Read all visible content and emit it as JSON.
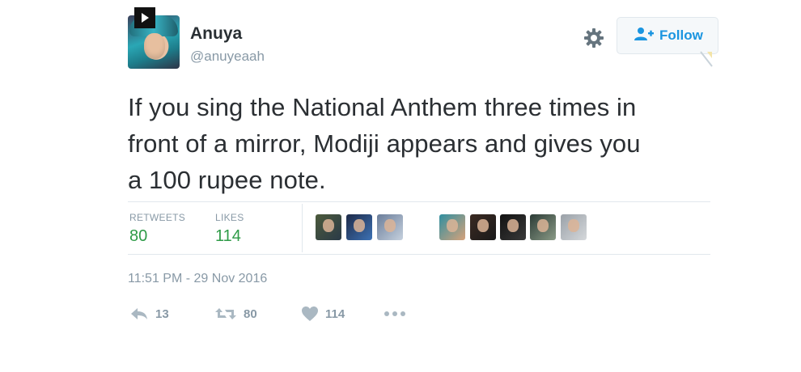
{
  "user": {
    "name": "Anuya",
    "handle": "@anuyeaah"
  },
  "header": {
    "follow_label": "Follow",
    "settings_icon": "gear-icon",
    "follow_icon": "add-user-icon",
    "play_icon": "play-icon"
  },
  "tweet": {
    "text_lines": [
      "If you sing the National Anthem three times in",
      "front of a mirror, Modiji appears and gives you",
      "a 100 rupee note."
    ],
    "timestamp": "11:51 PM - 29 Nov 2016"
  },
  "stats": {
    "retweets_label": "RETWEETS",
    "retweets": "80",
    "likes_label": "LIKES",
    "likes": "114"
  },
  "likers": [
    {
      "icon": "avatar"
    },
    {
      "icon": "avatar"
    },
    {
      "icon": "avatar"
    },
    {
      "icon": "avatar"
    },
    {
      "icon": "avatar"
    },
    {
      "icon": "avatar"
    },
    {
      "icon": "avatar"
    },
    {
      "icon": "avatar"
    }
  ],
  "actions": {
    "reply_count": "13",
    "retweet_count": "80",
    "like_count": "114"
  },
  "colors": {
    "accent": "#1b95e0",
    "stat_value": "#2e9b47",
    "muted": "#8899a6",
    "text": "#292f33"
  }
}
